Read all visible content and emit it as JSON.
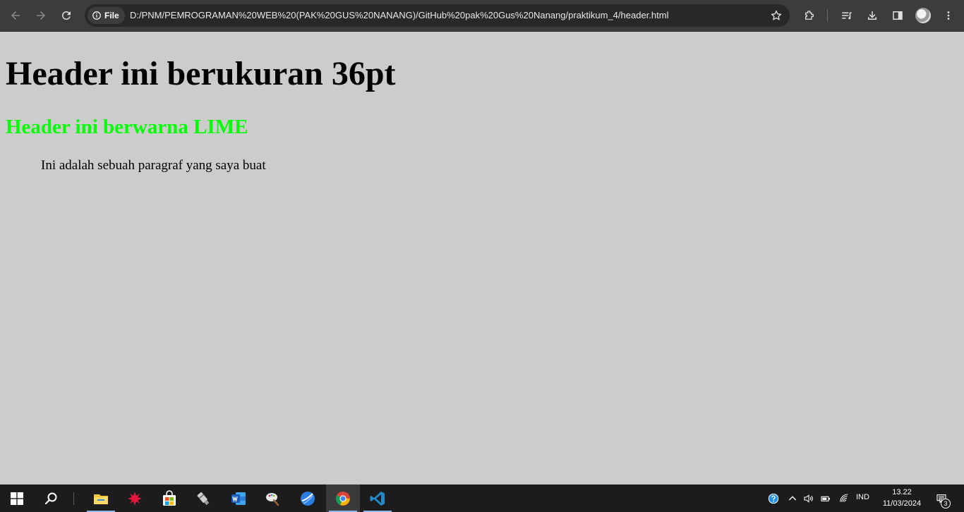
{
  "browser": {
    "site_chip_label": "File",
    "url": "D:/PNM/PEMROGRAMAN%20WEB%20(PAK%20GUS%20NANANG)/GitHub%20pak%20Gus%20Nanang/praktikum_4/header.html",
    "icons": [
      "back-icon",
      "forward-icon",
      "reload-icon",
      "info-icon",
      "star-icon",
      "extensions-icon",
      "reading-list-icon",
      "download-icon",
      "side-panel-icon",
      "profile-avatar",
      "more-icon"
    ]
  },
  "page": {
    "heading1": "Header ini berukuran 36pt",
    "heading2": "Header ini berwarna LIME",
    "paragraph": "Ini adalah sebuah paragraf yang saya buat",
    "background_color": "#cccccc",
    "heading2_color": "#00ff00"
  },
  "taskbar": {
    "apps": [
      "windows-start",
      "search",
      "file-explorer",
      "red-app",
      "microsoft-store",
      "usb-tool",
      "microsoft-word",
      "paint-app",
      "browser-globe",
      "google-chrome",
      "visual-studio-code"
    ],
    "active_app": "google-chrome",
    "language": "IND",
    "time": "13.22",
    "date": "11/03/2024",
    "notification_count": "3"
  }
}
